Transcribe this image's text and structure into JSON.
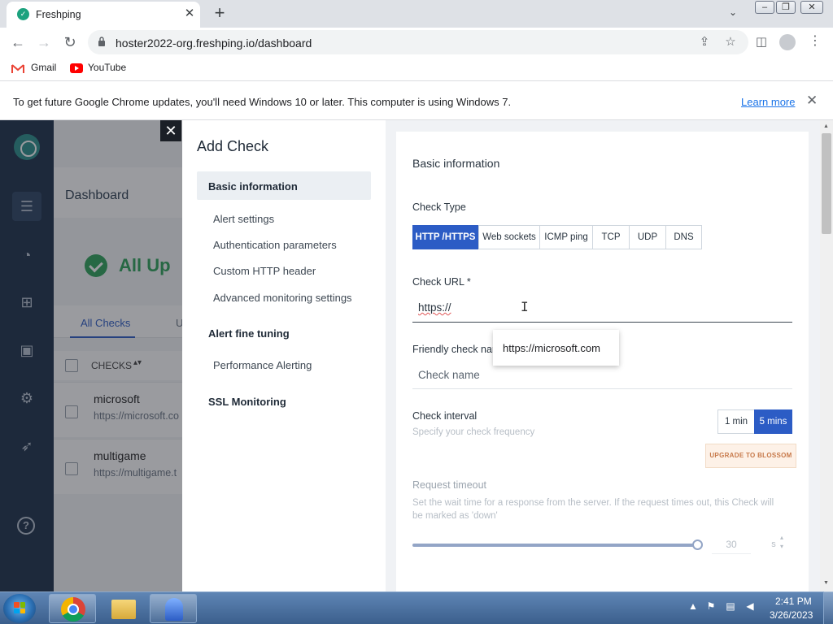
{
  "browser": {
    "tab_title": "Freshping",
    "url": "hoster2022-org.freshping.io/dashboard",
    "bookmarks": [
      "Gmail",
      "YouTube"
    ],
    "infobar_text": "To get future Google Chrome updates, you'll need Windows 10 or later. This computer is using Windows 7.",
    "infobar_link": "Learn more"
  },
  "dashboard": {
    "title": "Dashboard",
    "status": "All Up",
    "tabs": [
      "All Checks",
      "U"
    ],
    "list_header": "CHECKS",
    "checks": [
      {
        "name": "microsoft",
        "url": "https://microsoft.co"
      },
      {
        "name": "multigame",
        "url": "https://multigame.t"
      }
    ]
  },
  "modal": {
    "title": "Add Check",
    "nav": {
      "basic_information": "Basic information",
      "alert_settings": "Alert settings",
      "authentication_parameters": "Authentication parameters",
      "custom_http_header": "Custom HTTP header",
      "advanced_monitoring": "Advanced monitoring settings",
      "alert_fine_tuning": "Alert fine tuning",
      "performance_alerting": "Performance Alerting",
      "ssl_monitoring": "SSL Monitoring"
    },
    "section_title": "Basic information",
    "check_type_label": "Check Type",
    "check_types": [
      "HTTP /HTTPS",
      "Web sockets",
      "ICMP ping",
      "TCP",
      "UDP",
      "DNS"
    ],
    "selected_check_type": "HTTP /HTTPS",
    "check_url_label": "Check URL *",
    "check_url_value": "https://",
    "autocomplete_suggestion": "https://microsoft.com",
    "friendly_name_label": "Friendly check nam",
    "friendly_name_placeholder": "Check name",
    "interval_label": "Check interval",
    "interval_help": "Specify your check frequency",
    "interval_options": [
      "1 min",
      "5 mins"
    ],
    "interval_selected": "5 mins",
    "upgrade_label": "UPGRADE TO BLOSSOM",
    "timeout_label": "Request timeout",
    "timeout_help": "Set the wait time for a response from the server. If the request times out, this Check will be marked as 'down'",
    "timeout_value": "30",
    "timeout_unit": "s"
  },
  "taskbar": {
    "time": "2:41 PM",
    "date": "3/26/2023"
  },
  "colors": {
    "primary": "#2c5cc5",
    "sidebar": "#1d3049",
    "success": "#2ea35a",
    "upgrade": "#c7794a"
  }
}
